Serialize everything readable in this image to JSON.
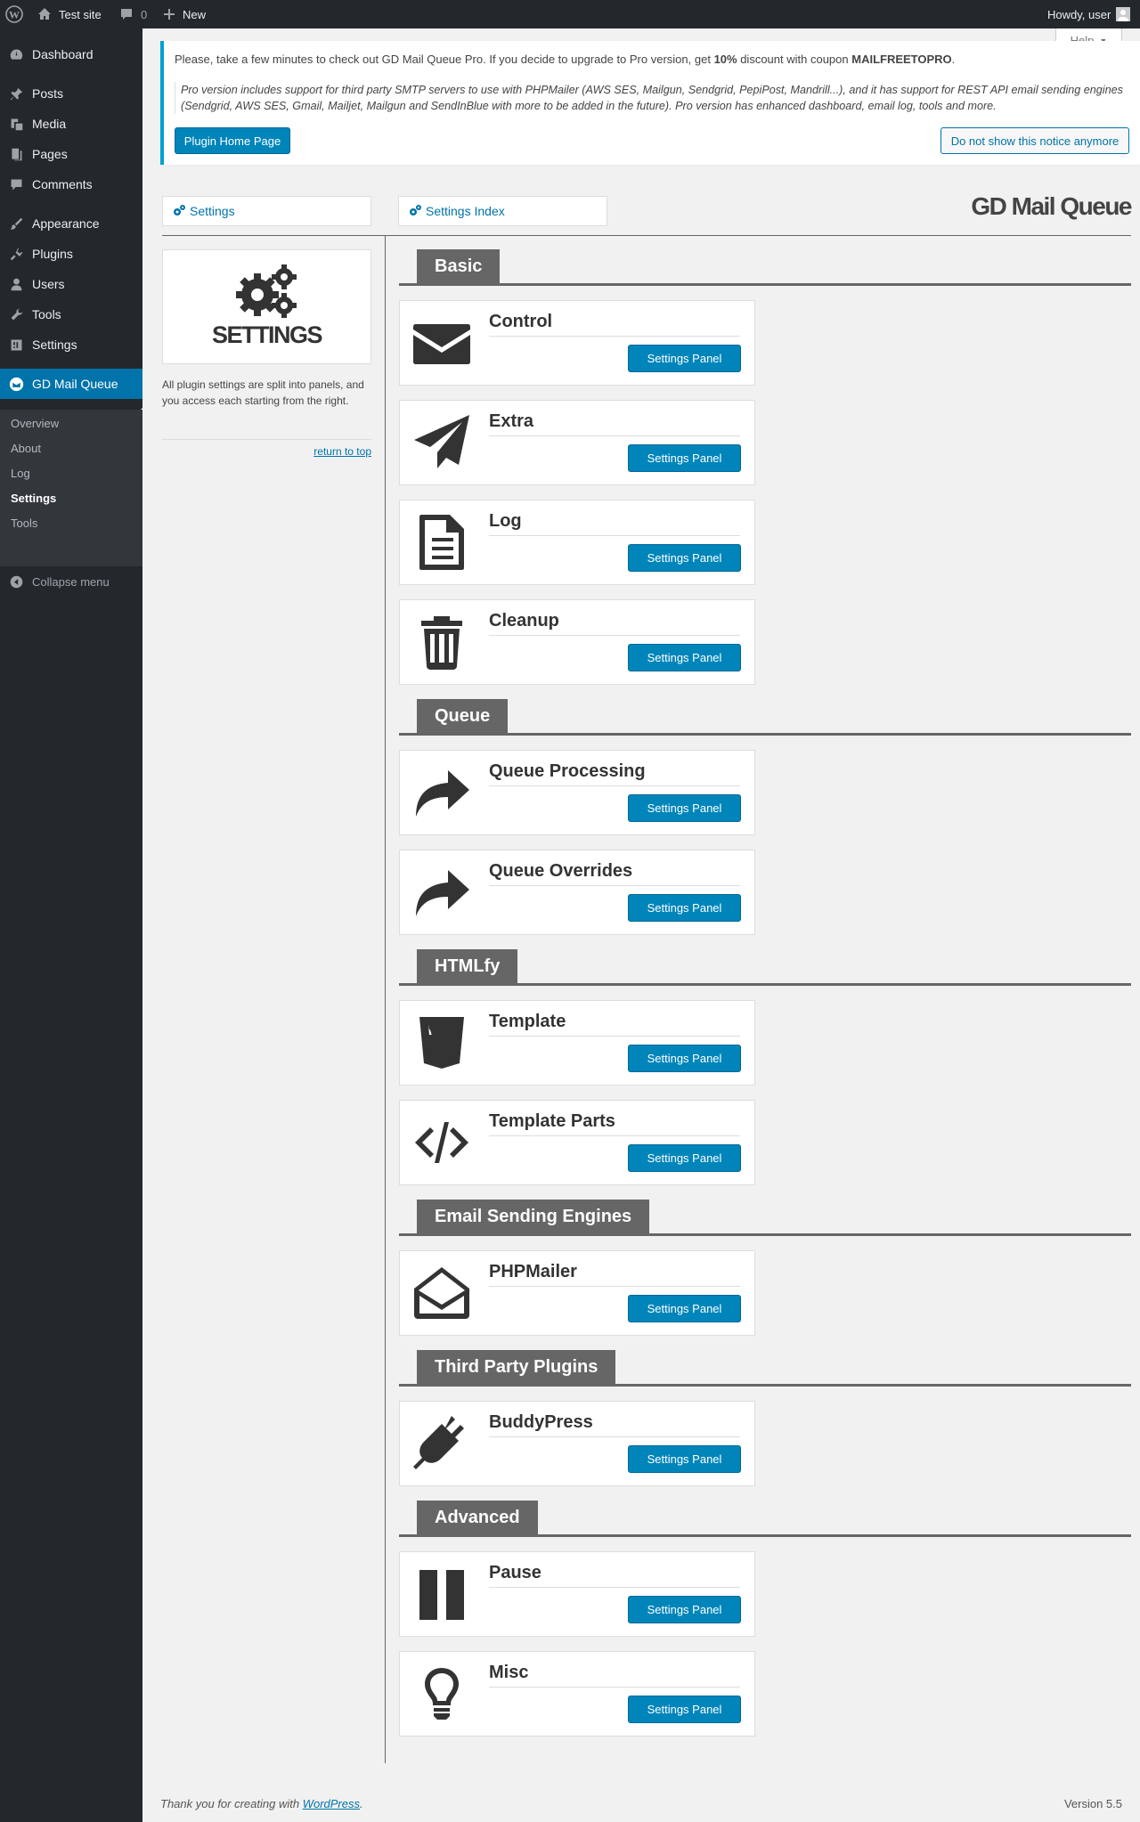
{
  "adminbar": {
    "site_name": "Test site",
    "comments_count": "0",
    "new_label": "New",
    "howdy": "Howdy, user",
    "help_label": "Help"
  },
  "menu": {
    "items": [
      {
        "label": "Dashboard",
        "icon": "dashboard-icon"
      },
      {
        "label": "Posts",
        "icon": "pin-icon"
      },
      {
        "label": "Media",
        "icon": "media-icon"
      },
      {
        "label": "Pages",
        "icon": "pages-icon"
      },
      {
        "label": "Comments",
        "icon": "comment-icon"
      },
      {
        "label": "Appearance",
        "icon": "brush-icon"
      },
      {
        "label": "Plugins",
        "icon": "plugin-icon"
      },
      {
        "label": "Users",
        "icon": "user-icon"
      },
      {
        "label": "Tools",
        "icon": "wrench-icon"
      },
      {
        "label": "Settings",
        "icon": "settings-icon"
      },
      {
        "label": "GD Mail Queue",
        "icon": "mail-icon"
      }
    ],
    "submenu": [
      "Overview",
      "About",
      "Log",
      "Settings",
      "Tools"
    ],
    "collapse": "Collapse menu"
  },
  "notice": {
    "line_before": "Please, take a few minutes to check out GD Mail Queue Pro. If you decide to upgrade to Pro version, get ",
    "discount": "10%",
    "line_mid": " discount with coupon ",
    "coupon": "MAILFREETOPRO",
    "line_end": ".",
    "pro_text": "Pro version includes support for third party SMTP servers to use with PHPMailer (AWS SES, Mailgun, Sendgrid, PepiPost, Mandrill...), and it has support for REST API email sending engines (Sendgrid, AWS SES, Gmail, Mailjet, Mailgun and SendInBlue with more to be added in the future). Pro version has enhanced dashboard, email log, tools and more.",
    "home_button": "Plugin Home Page",
    "dismiss_button": "Do not show this notice anymore"
  },
  "tabs": {
    "settings": "Settings",
    "settings_index": "Settings Index"
  },
  "plugin_title": "GD Mail Queue",
  "sidebar": {
    "badge_title": "SETTINGS",
    "description": "All plugin settings are split into panels, and you access each starting from the right.",
    "return_link": "return to top"
  },
  "sections": [
    {
      "name": "Basic",
      "panels": [
        {
          "title": "Control",
          "icon": "envelope-icon"
        },
        {
          "title": "Extra",
          "icon": "paper-plane-icon"
        },
        {
          "title": "Log",
          "icon": "file-text-icon"
        },
        {
          "title": "Cleanup",
          "icon": "trash-icon"
        }
      ]
    },
    {
      "name": "Queue",
      "panels": [
        {
          "title": "Queue Processing",
          "icon": "share-arrow-icon"
        },
        {
          "title": "Queue Overrides",
          "icon": "share-arrow-icon"
        }
      ]
    },
    {
      "name": "HTMLfy",
      "panels": [
        {
          "title": "Template",
          "icon": "html5-icon"
        },
        {
          "title": "Template Parts",
          "icon": "code-icon"
        }
      ]
    },
    {
      "name": "Email Sending Engines",
      "panels": [
        {
          "title": "PHPMailer",
          "icon": "envelope-open-icon"
        }
      ]
    },
    {
      "name": "Third Party Plugins",
      "panels": [
        {
          "title": "BuddyPress",
          "icon": "plug-icon"
        }
      ]
    },
    {
      "name": "Advanced",
      "panels": [
        {
          "title": "Pause",
          "icon": "pause-icon"
        },
        {
          "title": "Misc",
          "icon": "lightbulb-icon"
        }
      ]
    }
  ],
  "panel_button": "Settings Panel",
  "footer": {
    "thanks": "Thank you for creating with ",
    "wp_link": "WordPress",
    "thanks_end": ".",
    "version": "Version 5.5"
  }
}
